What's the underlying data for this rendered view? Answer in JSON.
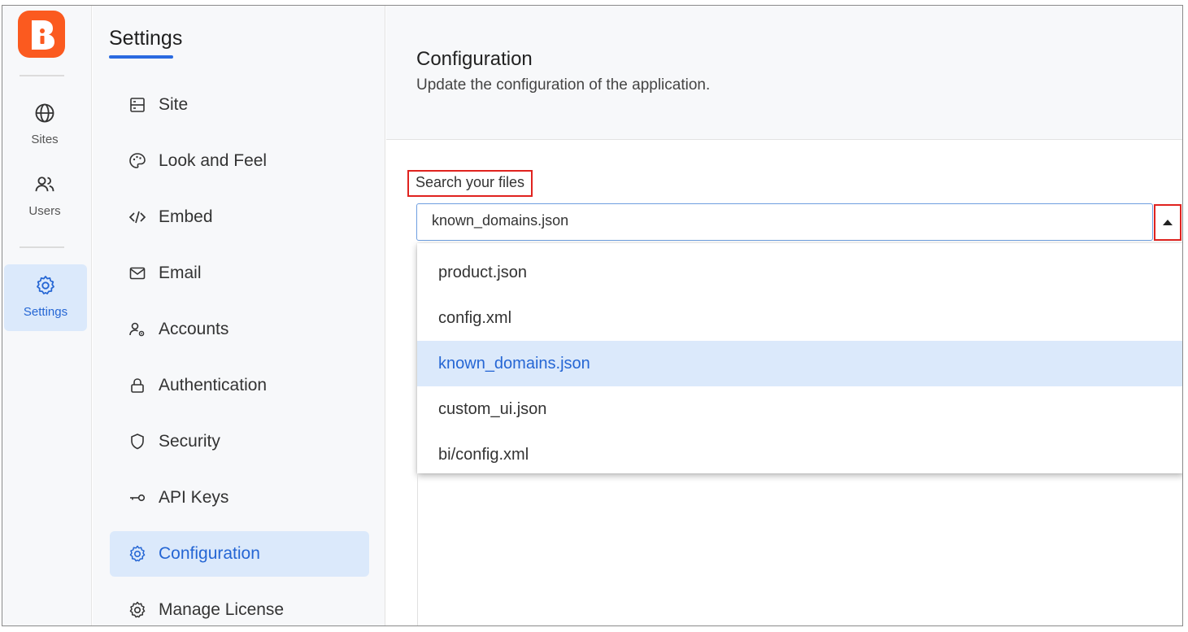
{
  "rail": {
    "items": [
      {
        "label": "Sites",
        "icon": "globe-icon"
      },
      {
        "label": "Users",
        "icon": "users-icon"
      },
      {
        "label": "Settings",
        "icon": "gear-icon",
        "active": true
      }
    ]
  },
  "sidebar": {
    "title": "Settings",
    "items": [
      {
        "label": "Site",
        "icon": "server-icon"
      },
      {
        "label": "Look and Feel",
        "icon": "palette-icon"
      },
      {
        "label": "Embed",
        "icon": "code-icon"
      },
      {
        "label": "Email",
        "icon": "mail-icon"
      },
      {
        "label": "Accounts",
        "icon": "user-gear-icon"
      },
      {
        "label": "Authentication",
        "icon": "lock-icon"
      },
      {
        "label": "Security",
        "icon": "shield-icon"
      },
      {
        "label": "API Keys",
        "icon": "key-icon"
      },
      {
        "label": "Configuration",
        "icon": "gear-icon",
        "active": true
      },
      {
        "label": "Manage License",
        "icon": "gear-icon"
      }
    ]
  },
  "main": {
    "title": "Configuration",
    "description": "Update the configuration of the application.",
    "field_label": "Search your files",
    "selected_value": "known_domains.json",
    "options": [
      {
        "label": "product.json"
      },
      {
        "label": "config.xml"
      },
      {
        "label": "known_domains.json",
        "selected": true
      },
      {
        "label": "custom_ui.json"
      },
      {
        "label": "bi/config.xml"
      }
    ]
  },
  "colors": {
    "brand": "#fb5a1f",
    "accent": "#2566d4",
    "highlight": "#dbe9fb",
    "annotation": "#e0231f"
  }
}
